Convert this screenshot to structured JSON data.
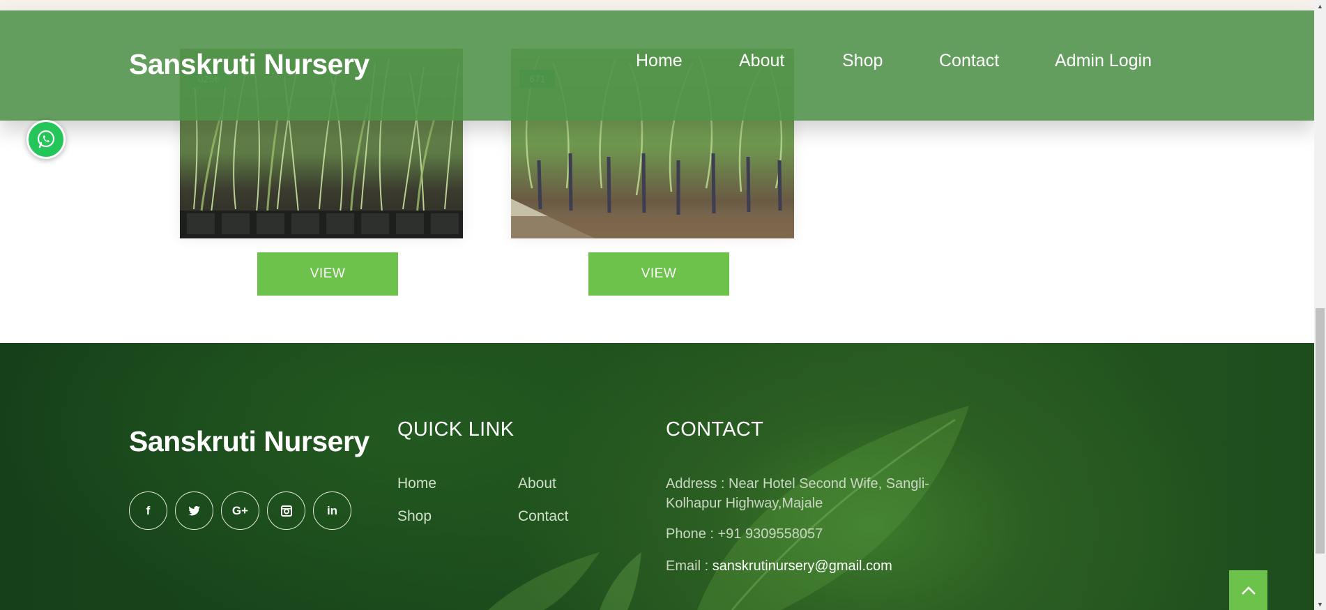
{
  "header": {
    "brand": "Sanskruti Nursery",
    "nav": [
      "Home",
      "About",
      "Shop",
      "Contact",
      "Admin Login"
    ]
  },
  "products": [
    {
      "sku": "0256",
      "button": "VIEW"
    },
    {
      "sku": "671",
      "button": "VIEW"
    }
  ],
  "footer": {
    "brand": "Sanskruti Nursery",
    "socials": [
      "facebook-icon",
      "twitter-icon",
      "google-plus-icon",
      "instagram-icon",
      "linkedin-icon"
    ],
    "social_glyphs": [
      "f",
      "🐦",
      "G+",
      "◻",
      "in"
    ],
    "quick_link_heading": "QUICK LINK",
    "quick_links": [
      "Home",
      "About",
      "Shop",
      "Contact"
    ],
    "contact_heading": "CONTACT",
    "address_line1": "Address : Near Hotel Second Wife, Sangli-",
    "address_line2": "Kolhapur Highway,Majale",
    "phone": "Phone : +91 9309558057",
    "email_label": "Email :",
    "email": "sanskrutinursery@gmail.com"
  },
  "colors": {
    "header_green": "#4d9148",
    "button_green": "#6cc24a",
    "footer_dark": "#1b4a1c",
    "whatsapp": "#25c659"
  }
}
